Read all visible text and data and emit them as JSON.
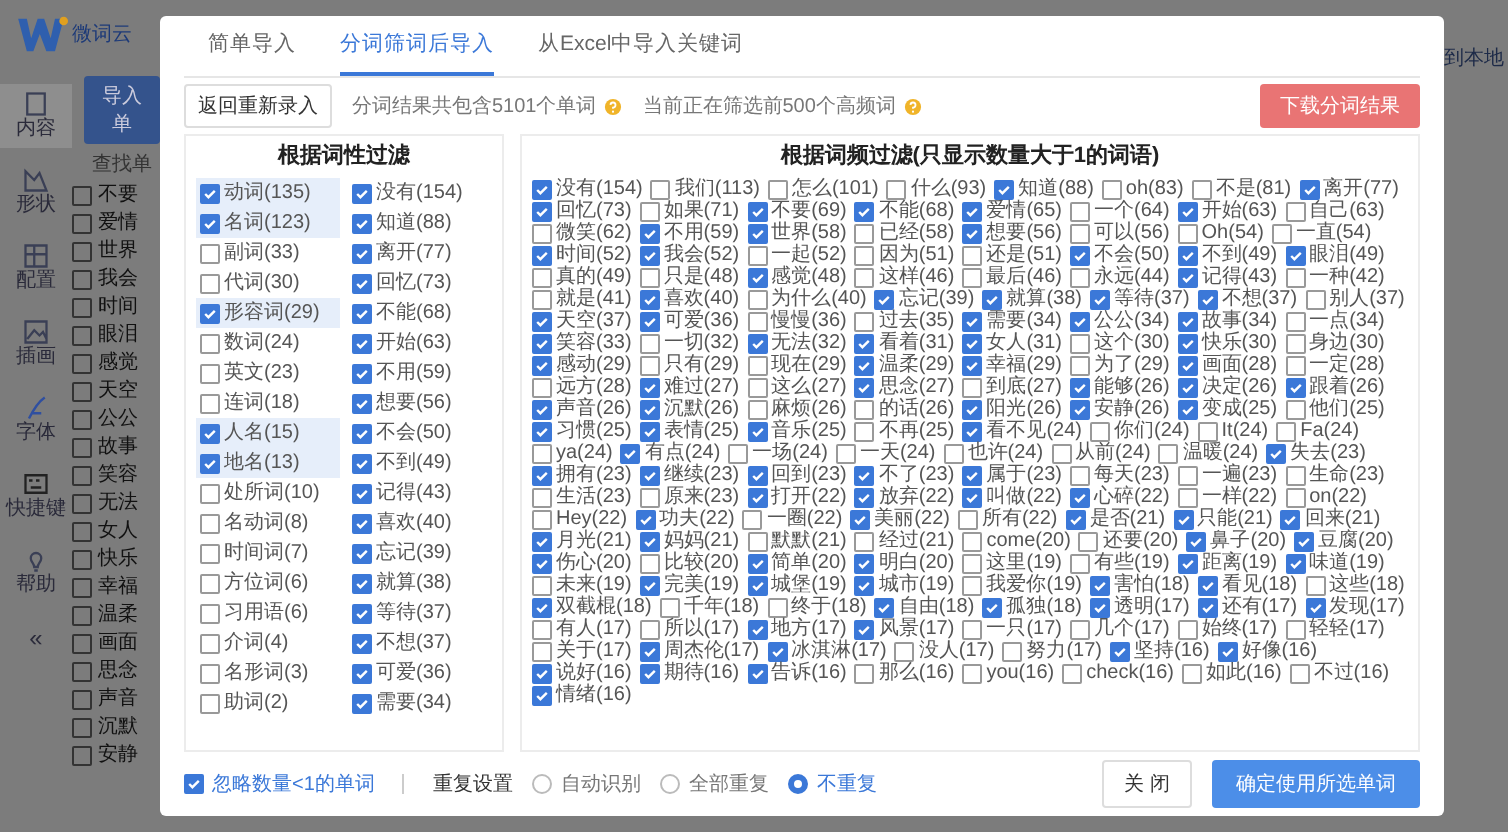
{
  "app": {
    "logo": "微词云",
    "import_button": "导入单",
    "search_label": "查找单",
    "export_link": "到本地",
    "collapse": "«",
    "nav": [
      {
        "label": "内容",
        "selected": true
      },
      {
        "label": "形状",
        "selected": false
      },
      {
        "label": "配置",
        "selected": false
      },
      {
        "label": "插画",
        "selected": false
      },
      {
        "label": "字体",
        "selected": false
      },
      {
        "label": "快捷键",
        "selected": false
      },
      {
        "label": "帮助",
        "selected": false
      }
    ],
    "words": [
      {
        "label": "不要",
        "checked": false
      },
      {
        "label": "爱情",
        "checked": false
      },
      {
        "label": "世界",
        "checked": false
      },
      {
        "label": "我会",
        "checked": false
      },
      {
        "label": "时间",
        "checked": false
      },
      {
        "label": "眼泪",
        "checked": false
      },
      {
        "label": "感觉",
        "checked": false
      },
      {
        "label": "天空",
        "checked": false
      },
      {
        "label": "公公",
        "checked": false
      },
      {
        "label": "故事",
        "checked": false
      },
      {
        "label": "笑容",
        "checked": false
      },
      {
        "label": "无法",
        "checked": false
      },
      {
        "label": "女人",
        "checked": false
      },
      {
        "label": "快乐",
        "checked": false
      },
      {
        "label": "幸福",
        "checked": false
      },
      {
        "label": "温柔",
        "checked": false
      },
      {
        "label": "画面",
        "checked": false
      },
      {
        "label": "思念",
        "checked": false
      },
      {
        "label": "声音",
        "checked": false
      },
      {
        "label": "沉默",
        "checked": false
      },
      {
        "label": "安静",
        "checked": false
      }
    ]
  },
  "dialog": {
    "tabs": [
      {
        "label": "简单导入",
        "selected": false
      },
      {
        "label": "分词筛词后导入",
        "selected": true
      },
      {
        "label": "从Excel中导入关键词",
        "selected": false
      }
    ],
    "toolbar": {
      "back_button": "返回重新录入",
      "total_text": "分词结果共包含5101个单词",
      "filter_text": "当前正在筛选前500个高频词",
      "download_button": "下载分词结果"
    },
    "pos_panel": {
      "title": "根据词性过滤",
      "columns": [
        [
          {
            "label": "动词(135)",
            "checked": true
          },
          {
            "label": "名词(123)",
            "checked": true
          },
          {
            "label": "副词(33)",
            "checked": false
          },
          {
            "label": "代词(30)",
            "checked": false
          },
          {
            "label": "形容词(29)",
            "checked": true
          },
          {
            "label": "数词(24)",
            "checked": false
          },
          {
            "label": "英文(23)",
            "checked": false
          },
          {
            "label": "连词(18)",
            "checked": false
          },
          {
            "label": "人名(15)",
            "checked": true
          },
          {
            "label": "地名(13)",
            "checked": true
          },
          {
            "label": "处所词(10)",
            "checked": false
          },
          {
            "label": "名动词(8)",
            "checked": false
          },
          {
            "label": "时间词(7)",
            "checked": false
          },
          {
            "label": "方位词(6)",
            "checked": false
          },
          {
            "label": "习用语(6)",
            "checked": false
          },
          {
            "label": "介词(4)",
            "checked": false
          },
          {
            "label": "名形词(3)",
            "checked": false
          },
          {
            "label": "助词(2)",
            "checked": false
          }
        ],
        [
          {
            "label": "没有(154)",
            "checked": true
          },
          {
            "label": "知道(88)",
            "checked": true
          },
          {
            "label": "离开(77)",
            "checked": true
          },
          {
            "label": "回忆(73)",
            "checked": true
          },
          {
            "label": "不能(68)",
            "checked": true
          },
          {
            "label": "开始(63)",
            "checked": true
          },
          {
            "label": "不用(59)",
            "checked": true
          },
          {
            "label": "想要(56)",
            "checked": true
          },
          {
            "label": "不会(50)",
            "checked": true
          },
          {
            "label": "不到(49)",
            "checked": true
          },
          {
            "label": "记得(43)",
            "checked": true
          },
          {
            "label": "喜欢(40)",
            "checked": true
          },
          {
            "label": "忘记(39)",
            "checked": true
          },
          {
            "label": "就算(38)",
            "checked": true
          },
          {
            "label": "等待(37)",
            "checked": true
          },
          {
            "label": "不想(37)",
            "checked": true
          },
          {
            "label": "可爱(36)",
            "checked": true
          },
          {
            "label": "需要(34)",
            "checked": true
          }
        ]
      ]
    },
    "freq_panel": {
      "title": "根据词频过滤(只显示数量大于1的词语)",
      "items": [
        {
          "label": "没有(154)",
          "checked": true
        },
        {
          "label": "我们(113)",
          "checked": false
        },
        {
          "label": "怎么(101)",
          "checked": false
        },
        {
          "label": "什么(93)",
          "checked": false
        },
        {
          "label": "知道(88)",
          "checked": true
        },
        {
          "label": "oh(83)",
          "checked": false
        },
        {
          "label": "不是(81)",
          "checked": false
        },
        {
          "label": "离开(77)",
          "checked": true
        },
        {
          "label": "回忆(73)",
          "checked": true
        },
        {
          "label": "如果(71)",
          "checked": false
        },
        {
          "label": "不要(69)",
          "checked": true
        },
        {
          "label": "不能(68)",
          "checked": true
        },
        {
          "label": "爱情(65)",
          "checked": true
        },
        {
          "label": "一个(64)",
          "checked": false
        },
        {
          "label": "开始(63)",
          "checked": true
        },
        {
          "label": "自己(63)",
          "checked": false
        },
        {
          "label": "微笑(62)",
          "checked": false
        },
        {
          "label": "不用(59)",
          "checked": true
        },
        {
          "label": "世界(58)",
          "checked": true
        },
        {
          "label": "已经(58)",
          "checked": false
        },
        {
          "label": "想要(56)",
          "checked": true
        },
        {
          "label": "可以(56)",
          "checked": false
        },
        {
          "label": "Oh(54)",
          "checked": false
        },
        {
          "label": "一直(54)",
          "checked": false
        },
        {
          "label": "时间(52)",
          "checked": true
        },
        {
          "label": "我会(52)",
          "checked": true
        },
        {
          "label": "一起(52)",
          "checked": false
        },
        {
          "label": "因为(51)",
          "checked": false
        },
        {
          "label": "还是(51)",
          "checked": false
        },
        {
          "label": "不会(50)",
          "checked": true
        },
        {
          "label": "不到(49)",
          "checked": true
        },
        {
          "label": "眼泪(49)",
          "checked": true
        },
        {
          "label": "真的(49)",
          "checked": false
        },
        {
          "label": "只是(48)",
          "checked": false
        },
        {
          "label": "感觉(48)",
          "checked": true
        },
        {
          "label": "这样(46)",
          "checked": false
        },
        {
          "label": "最后(46)",
          "checked": false
        },
        {
          "label": "永远(44)",
          "checked": false
        },
        {
          "label": "记得(43)",
          "checked": true
        },
        {
          "label": "一种(42)",
          "checked": false
        },
        {
          "label": "就是(41)",
          "checked": false
        },
        {
          "label": "喜欢(40)",
          "checked": true
        },
        {
          "label": "为什么(40)",
          "checked": false
        },
        {
          "label": "忘记(39)",
          "checked": true
        },
        {
          "label": "就算(38)",
          "checked": true
        },
        {
          "label": "等待(37)",
          "checked": true
        },
        {
          "label": "不想(37)",
          "checked": true
        },
        {
          "label": "别人(37)",
          "checked": false
        },
        {
          "label": "天空(37)",
          "checked": true
        },
        {
          "label": "可爱(36)",
          "checked": true
        },
        {
          "label": "慢慢(36)",
          "checked": false
        },
        {
          "label": "过去(35)",
          "checked": false
        },
        {
          "label": "需要(34)",
          "checked": true
        },
        {
          "label": "公公(34)",
          "checked": true
        },
        {
          "label": "故事(34)",
          "checked": true
        },
        {
          "label": "一点(34)",
          "checked": false
        },
        {
          "label": "笑容(33)",
          "checked": true
        },
        {
          "label": "一切(32)",
          "checked": false
        },
        {
          "label": "无法(32)",
          "checked": true
        },
        {
          "label": "看着(31)",
          "checked": true
        },
        {
          "label": "女人(31)",
          "checked": true
        },
        {
          "label": "这个(30)",
          "checked": false
        },
        {
          "label": "快乐(30)",
          "checked": true
        },
        {
          "label": "身边(30)",
          "checked": false
        },
        {
          "label": "感动(29)",
          "checked": true
        },
        {
          "label": "只有(29)",
          "checked": false
        },
        {
          "label": "现在(29)",
          "checked": false
        },
        {
          "label": "温柔(29)",
          "checked": true
        },
        {
          "label": "幸福(29)",
          "checked": true
        },
        {
          "label": "为了(29)",
          "checked": false
        },
        {
          "label": "画面(28)",
          "checked": true
        },
        {
          "label": "一定(28)",
          "checked": false
        },
        {
          "label": "远方(28)",
          "checked": false
        },
        {
          "label": "难过(27)",
          "checked": true
        },
        {
          "label": "这么(27)",
          "checked": false
        },
        {
          "label": "思念(27)",
          "checked": true
        },
        {
          "label": "到底(27)",
          "checked": false
        },
        {
          "label": "能够(26)",
          "checked": true
        },
        {
          "label": "决定(26)",
          "checked": true
        },
        {
          "label": "跟着(26)",
          "checked": true
        },
        {
          "label": "声音(26)",
          "checked": true
        },
        {
          "label": "沉默(26)",
          "checked": true
        },
        {
          "label": "麻烦(26)",
          "checked": false
        },
        {
          "label": "的话(26)",
          "checked": false
        },
        {
          "label": "阳光(26)",
          "checked": true
        },
        {
          "label": "安静(26)",
          "checked": true
        },
        {
          "label": "变成(25)",
          "checked": true
        },
        {
          "label": "他们(25)",
          "checked": false
        },
        {
          "label": "习惯(25)",
          "checked": true
        },
        {
          "label": "表情(25)",
          "checked": true
        },
        {
          "label": "音乐(25)",
          "checked": true
        },
        {
          "label": "不再(25)",
          "checked": false
        },
        {
          "label": "看不见(24)",
          "checked": true
        },
        {
          "label": "你们(24)",
          "checked": false
        },
        {
          "label": "It(24)",
          "checked": false
        },
        {
          "label": "Fa(24)",
          "checked": false
        },
        {
          "label": "ya(24)",
          "checked": false
        },
        {
          "label": "有点(24)",
          "checked": true
        },
        {
          "label": "一场(24)",
          "checked": false
        },
        {
          "label": "一天(24)",
          "checked": false
        },
        {
          "label": "也许(24)",
          "checked": false
        },
        {
          "label": "从前(24)",
          "checked": false
        },
        {
          "label": "温暖(24)",
          "checked": false
        },
        {
          "label": "失去(23)",
          "checked": true
        },
        {
          "label": "拥有(23)",
          "checked": true
        },
        {
          "label": "继续(23)",
          "checked": true
        },
        {
          "label": "回到(23)",
          "checked": true
        },
        {
          "label": "不了(23)",
          "checked": true
        },
        {
          "label": "属于(23)",
          "checked": true
        },
        {
          "label": "每天(23)",
          "checked": false
        },
        {
          "label": "一遍(23)",
          "checked": false
        },
        {
          "label": "生命(23)",
          "checked": false
        },
        {
          "label": "生活(23)",
          "checked": false
        },
        {
          "label": "原来(23)",
          "checked": false
        },
        {
          "label": "打开(22)",
          "checked": true
        },
        {
          "label": "放弃(22)",
          "checked": true
        },
        {
          "label": "叫做(22)",
          "checked": true
        },
        {
          "label": "心碎(22)",
          "checked": true
        },
        {
          "label": "一样(22)",
          "checked": false
        },
        {
          "label": "on(22)",
          "checked": false
        },
        {
          "label": "Hey(22)",
          "checked": false
        },
        {
          "label": "功夫(22)",
          "checked": true
        },
        {
          "label": "一圈(22)",
          "checked": false
        },
        {
          "label": "美丽(22)",
          "checked": true
        },
        {
          "label": "所有(22)",
          "checked": false
        },
        {
          "label": "是否(21)",
          "checked": true
        },
        {
          "label": "只能(21)",
          "checked": true
        },
        {
          "label": "回来(21)",
          "checked": true
        },
        {
          "label": "月光(21)",
          "checked": true
        },
        {
          "label": "妈妈(21)",
          "checked": true
        },
        {
          "label": "默默(21)",
          "checked": false
        },
        {
          "label": "经过(21)",
          "checked": false
        },
        {
          "label": "come(20)",
          "checked": false
        },
        {
          "label": "还要(20)",
          "checked": false
        },
        {
          "label": "鼻子(20)",
          "checked": true
        },
        {
          "label": "豆腐(20)",
          "checked": true
        },
        {
          "label": "伤心(20)",
          "checked": true
        },
        {
          "label": "比较(20)",
          "checked": false
        },
        {
          "label": "简单(20)",
          "checked": true
        },
        {
          "label": "明白(20)",
          "checked": true
        },
        {
          "label": "这里(19)",
          "checked": false
        },
        {
          "label": "有些(19)",
          "checked": false
        },
        {
          "label": "距离(19)",
          "checked": true
        },
        {
          "label": "味道(19)",
          "checked": true
        },
        {
          "label": "未来(19)",
          "checked": false
        },
        {
          "label": "完美(19)",
          "checked": true
        },
        {
          "label": "城堡(19)",
          "checked": true
        },
        {
          "label": "城市(19)",
          "checked": true
        },
        {
          "label": "我爱你(19)",
          "checked": false
        },
        {
          "label": "害怕(18)",
          "checked": true
        },
        {
          "label": "看见(18)",
          "checked": true
        },
        {
          "label": "这些(18)",
          "checked": false
        },
        {
          "label": "双截棍(18)",
          "checked": true
        },
        {
          "label": "千年(18)",
          "checked": false
        },
        {
          "label": "终于(18)",
          "checked": false
        },
        {
          "label": "自由(18)",
          "checked": true
        },
        {
          "label": "孤独(18)",
          "checked": true
        },
        {
          "label": "透明(17)",
          "checked": true
        },
        {
          "label": "还有(17)",
          "checked": true
        },
        {
          "label": "发现(17)",
          "checked": true
        },
        {
          "label": "有人(17)",
          "checked": false
        },
        {
          "label": "所以(17)",
          "checked": false
        },
        {
          "label": "地方(17)",
          "checked": true
        },
        {
          "label": "风景(17)",
          "checked": true
        },
        {
          "label": "一只(17)",
          "checked": false
        },
        {
          "label": "几个(17)",
          "checked": false
        },
        {
          "label": "始终(17)",
          "checked": false
        },
        {
          "label": "轻轻(17)",
          "checked": false
        },
        {
          "label": "关于(17)",
          "checked": false
        },
        {
          "label": "周杰伦(17)",
          "checked": true
        },
        {
          "label": "冰淇淋(17)",
          "checked": true
        },
        {
          "label": "没人(17)",
          "checked": false
        },
        {
          "label": "努力(17)",
          "checked": false
        },
        {
          "label": "坚持(16)",
          "checked": true
        },
        {
          "label": "好像(16)",
          "checked": true
        },
        {
          "label": "说好(16)",
          "checked": true
        },
        {
          "label": "期待(16)",
          "checked": true
        },
        {
          "label": "告诉(16)",
          "checked": true
        },
        {
          "label": "那么(16)",
          "checked": false
        },
        {
          "label": "you(16)",
          "checked": false
        },
        {
          "label": "check(16)",
          "checked": false
        },
        {
          "label": "如此(16)",
          "checked": false
        },
        {
          "label": "不过(16)",
          "checked": false
        },
        {
          "label": "情绪(16)",
          "checked": true
        }
      ]
    },
    "footer": {
      "ignore": {
        "label": "忽略数量<1的单词",
        "checked": true
      },
      "repeat_label": "重复设置",
      "radios": [
        {
          "label": "自动识别",
          "selected": false
        },
        {
          "label": "全部重复",
          "selected": false
        },
        {
          "label": "不重复",
          "selected": true
        }
      ],
      "close_button": "关 闭",
      "confirm_button": "确定使用所选单词"
    }
  }
}
